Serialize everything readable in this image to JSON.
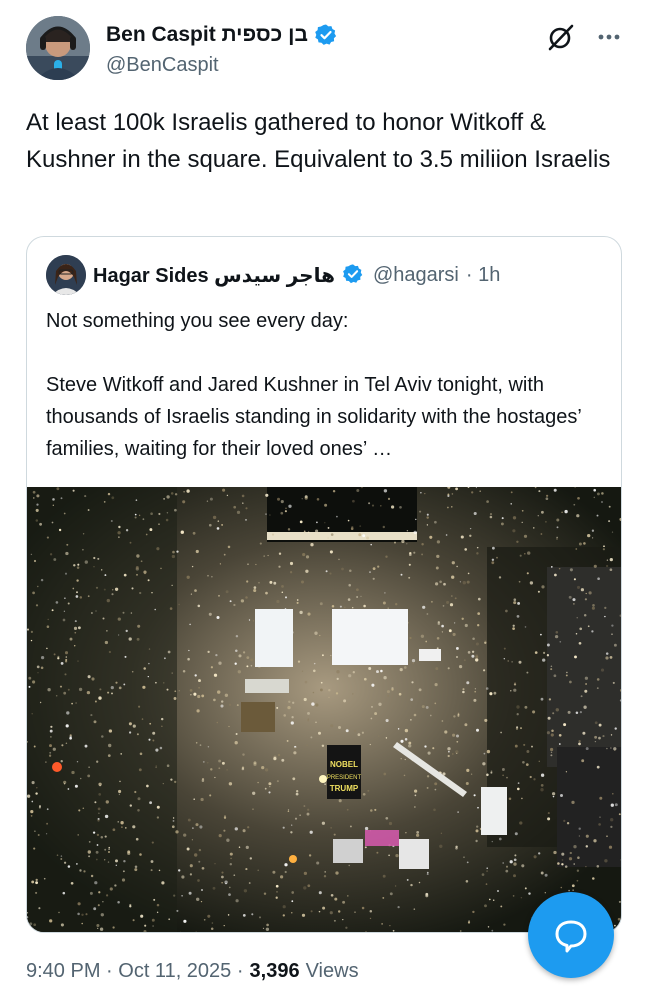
{
  "tweet": {
    "author_name": "Ben Caspit בן כספית",
    "author_handle": "@BenCaspit",
    "text": "At least 100k Israelis gathered to honor Witkoff & Kushner in the square. Equivalent to 3.5 miliion Israelis",
    "timestamp": "9:40 PM · Oct 11, 2025 · ",
    "views_count": "3,396",
    "views_label": "Views"
  },
  "quote": {
    "author_name": "Hagar Sides هاجر سيدس",
    "author_handle": "@hagarsi",
    "age": "· 1h",
    "text": "Not something you see every day:\n\nSteve Witkoff and Jared Kushner in Tel Aviv tonight, with thousands of Israelis standing in solidarity with the hostages’ families, waiting for their loved ones’ …",
    "image_sign_text": "NOBEL PRESIDENT TRUMP"
  },
  "icons": {
    "verified": "verified-badge-icon",
    "grok": "grok-icon",
    "more": "more-icon",
    "compose": "chat-bubble-icon"
  },
  "colors": {
    "accent": "#1d9bf0",
    "secondary_text": "#536471",
    "border": "#cfd9de"
  }
}
